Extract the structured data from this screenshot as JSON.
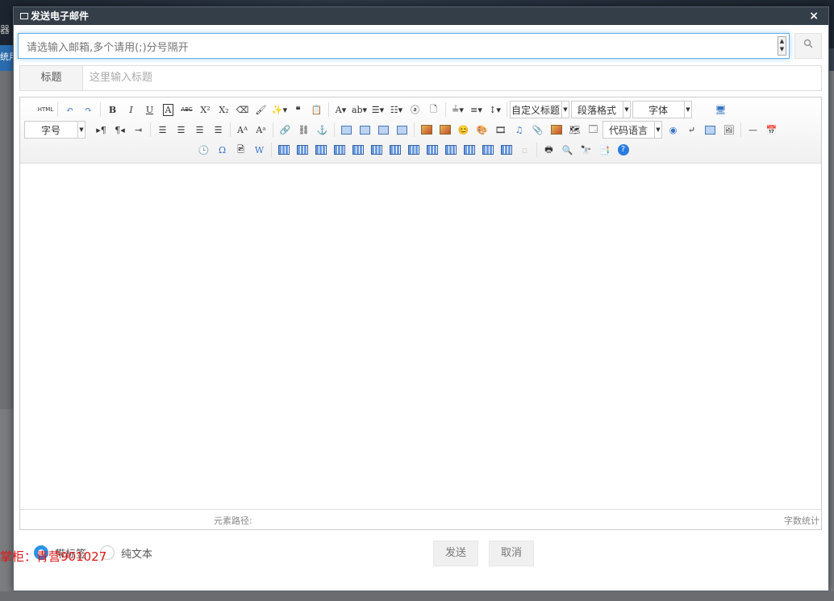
{
  "background": {
    "left_text_1": "器",
    "left_text_2": "统用户"
  },
  "dialog": {
    "title": "发送电子邮件",
    "close_label": "×",
    "recipients": {
      "placeholder": "请选输入邮箱,多个请用(;)分号隔开"
    },
    "subject": {
      "label": "标题",
      "placeholder": "这里输入标题"
    },
    "toolbar": {
      "html_label": "HTML",
      "custom_heading": "自定义标题",
      "paragraph_format": "段落格式",
      "font_family": "字体",
      "font_size": "字号",
      "code_language": "代码语言"
    },
    "editor_footer": {
      "element_path": "元素路径:",
      "word_count": "字数统计"
    },
    "format": {
      "option_html": "带标签",
      "option_text": "纯文本",
      "selected": "带标签"
    },
    "send_label": "发送",
    "cancel_label": "取消"
  },
  "watermark": "掌柜：青营901027"
}
